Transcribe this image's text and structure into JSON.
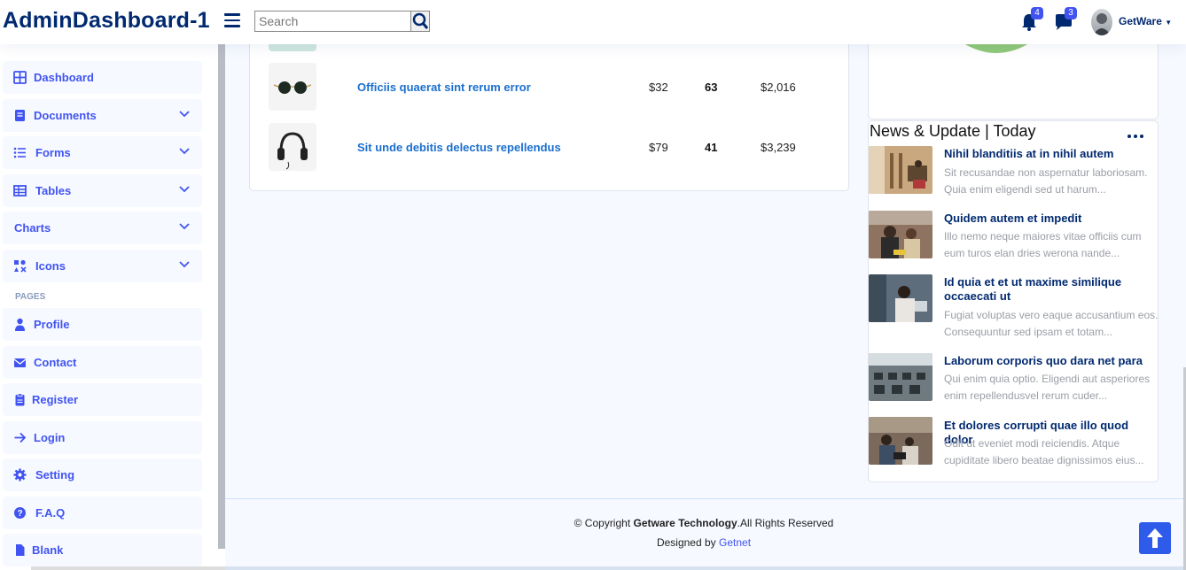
{
  "app": {
    "title": "AdminDashboard-1"
  },
  "header": {
    "search_placeholder": "Search",
    "notifications_count": "4",
    "messages_count": "3",
    "user_name": "GetWare"
  },
  "sidebar": {
    "items": [
      {
        "label": "Dashboard",
        "icon": "grid-icon"
      },
      {
        "label": "Documents",
        "icon": "document-icon"
      },
      {
        "label": "Forms",
        "icon": "list-icon"
      },
      {
        "label": "Tables",
        "icon": "table-icon"
      },
      {
        "label": "Charts",
        "icon": ""
      },
      {
        "label": "Icons",
        "icon": "icons-icon"
      }
    ],
    "pages_heading": "PAGES",
    "pages": [
      {
        "label": "Profile",
        "icon": "person-icon"
      },
      {
        "label": "Contact",
        "icon": "envelope-icon"
      },
      {
        "label": "Register",
        "icon": "clipboard-icon"
      },
      {
        "label": "Login",
        "icon": "arrow-right-icon"
      },
      {
        "label": "Setting",
        "icon": "gear-icon"
      },
      {
        "label": "F.A.Q",
        "icon": "question-icon"
      },
      {
        "label": "Blank",
        "icon": "file-icon"
      }
    ]
  },
  "top_selling": {
    "rows": [
      {
        "name": "Officiis quaerat sint rerum error",
        "price": "$32",
        "sold": "63",
        "revenue": "$2,016"
      },
      {
        "name": "Sit unde debitis delectus repellendus",
        "price": "$79",
        "sold": "41",
        "revenue": "$3,239"
      }
    ]
  },
  "news": {
    "title": "News & Update",
    "period": "Today",
    "items": [
      {
        "headline": "Nihil blanditiis at in nihil autem",
        "excerpt": "Sit recusandae non aspernatur laboriosam. Quia enim eligendi sed ut harum..."
      },
      {
        "headline": "Quidem autem et impedit",
        "excerpt": "Illo nemo neque maiores vitae officiis cum eum turos elan dries werona nande..."
      },
      {
        "headline": "Id quia et et ut maxime similique occaecati ut",
        "excerpt": "Fugiat voluptas vero eaque accusantium eos. Consequuntur sed ipsam et totam..."
      },
      {
        "headline": "Laborum corporis quo dara net para",
        "excerpt": "Qui enim quia optio. Eligendi aut asperiores enim repellendusvel rerum cuder..."
      },
      {
        "headline": "Et dolores corrupti quae illo quod dolor",
        "excerpt": "Odit ut eveniet modi reiciendis. Atque cupiditate libero beatae dignissimos eius..."
      }
    ]
  },
  "footer": {
    "copyright_prefix": "© Copyright ",
    "company": "Getware Technology",
    "copyright_suffix": ".All Rights Reserved",
    "designed_prefix": "Designed by ",
    "designer": "Getnet"
  },
  "colors": {
    "brand": "#012970",
    "accent": "#4154f1",
    "link": "#1a6fcf",
    "background": "#f6f9ff"
  }
}
